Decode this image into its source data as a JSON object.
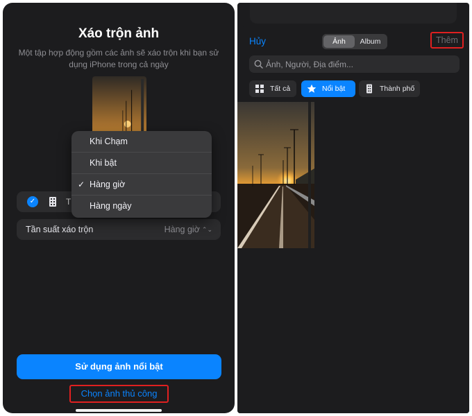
{
  "left_screen": {
    "title": "Xáo trộn ảnh",
    "subtitle": "Một tập hợp động gồm các ảnh sẽ xáo trộn khi bạn sử dụng iPhone trong cả ngày",
    "row1_text": "T",
    "shuffle_frequency": {
      "label": "Tần suất xáo trộn",
      "value": "Hàng giờ"
    },
    "menu": {
      "items": [
        "Khi Chạm",
        "Khi bật",
        "Hàng giờ",
        "Hàng ngày"
      ],
      "selected": "Hàng giờ"
    },
    "primary_button": "Sử dụng ảnh nổi bật",
    "manual_link": "Chọn ảnh thủ công"
  },
  "right_screen": {
    "cancel": "Hủy",
    "segments": [
      "Ảnh",
      "Album"
    ],
    "selected_segment": "Ảnh",
    "add": "Thêm",
    "search_placeholder": "Ảnh, Người, Địa điểm...",
    "filters": [
      {
        "label": "Tất cả",
        "icon": "grid-icon"
      },
      {
        "label": "Nổi bật",
        "icon": "star-icon"
      },
      {
        "label": "Thành phố",
        "icon": "building-icon"
      }
    ],
    "selected_filter": "Nổi bật"
  },
  "colors": {
    "accent": "#0a84ff",
    "highlight_box": "#e02020",
    "background": "#1c1c1e"
  }
}
